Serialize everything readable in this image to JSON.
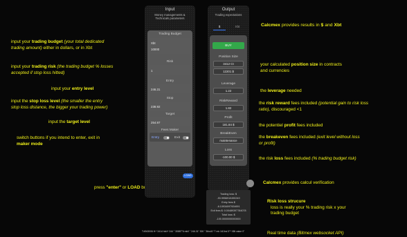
{
  "input_col": {
    "title": "Input",
    "subtitle": [
      "Money managements &",
      "Technicals parameters"
    ],
    "group_title": "Trading Budget",
    "budget_currency": "Xbt",
    "budget_value": "10000",
    "risk_label": "Risk",
    "risk_value": "1",
    "entry_label": "Entry",
    "entry_value": "246.31",
    "stop_label": "Stop",
    "stop_value": "238.92",
    "target_label": "Target",
    "target_value": "254.97",
    "feemaker_label": "Fees Maker",
    "feemaker_entry": "Entry",
    "feemaker_exit": "Exit",
    "load_label": "LOAD"
  },
  "output_col": {
    "title": "Output",
    "subtitle": "Trading expectations",
    "tab1": "$",
    "tab2": "Xbt",
    "buy_label": "BUY",
    "position_label": "Position Size",
    "position_contracts": "3412 Ct",
    "position_usd": "12201 $",
    "leverage_label": "Leverage",
    "leverage_value": "1.22",
    "rr_label": "RiskReward",
    "rr_value": "1.82",
    "profit_label": "Profit",
    "profit_value": "181.84 $",
    "breakeven_label": "BreakEven",
    "breakeven_value": "maintenance",
    "loss_label": "Loss",
    "loss_value": "-100.00 $"
  },
  "verification": {
    "lines": [
      "Trading loss: $",
      "-93.9956910490249",
      "Entry fees $",
      "-6.10934097924691",
      "Exit fees $: 0.00489397784078",
      "Total loss: $",
      "-100.0000000000000"
    ]
  },
  "ticker": "T:4943006 H:* 3414 hid:i* 244 \" 30887\"6 mk0 \" 246.31\" 300 \" 3ths40 \"7 mk 1t13nd 3\"* XBt value 0\"",
  "left_annotations": {
    "budget": {
      "a": "input your ",
      "b": "trading budget",
      "c": " (your total  dedicated",
      "d": "trading amount)",
      "e": "  either in dollars, or in Xbt"
    },
    "risk": {
      "a": "input your ",
      "b": "trading risk",
      "c": " (the trading budget % losses",
      "d": "accepted if stop loss hitted)"
    },
    "entry": {
      "a": "input your ",
      "b": "entry level"
    },
    "stop": {
      "a": "input the ",
      "b": "stop loss level",
      "c": " (the smaller the entry",
      "d": "stop loss distance, the bigger your trading power)"
    },
    "target": {
      "a": "input the ",
      "b": "target level"
    },
    "switch": {
      "a": "switch buttons if you intend to enter, exit in",
      "b": "maker mode"
    },
    "press": {
      "a": "press ",
      "b": "\"enter\"",
      "c": " or ",
      "d": "LOAD",
      "e": " button"
    }
  },
  "right_annotations": {
    "calcmex": {
      "a": "Calcmex",
      "b": " provides results in ",
      "c": "$",
      "d": " and ",
      "e": "Xbt"
    },
    "position": {
      "a": "your calculated ",
      "b": "position size",
      "c": " in contracts",
      "d": "and currencies"
    },
    "leverage": {
      "a": "the ",
      "b": "leverage",
      "c": " needed"
    },
    "rr": {
      "a": "the ",
      "b": "risk reward",
      "c": " fees included ",
      "d": "(potential gain to risk loss",
      "e": "ratio),",
      "f": "  discouraged <1"
    },
    "profit": {
      "a": "the potentiel ",
      "b": "profit",
      "c": " fees included"
    },
    "breakeven": {
      "a": "the ",
      "b": "breakeven",
      "c": " fees included ",
      "d": "(exit level without loss",
      "e": "or profit)"
    },
    "loss": {
      "a": "the risk ",
      "b": "loss",
      "c": " fees included ",
      "d": "(%  trading budget risk)"
    },
    "verif": {
      "a": "Calcmex",
      "b": " provides calcul verification"
    },
    "structure": {
      "a": "Risk loss strucure",
      "b": "loss is really your % trading risk x your",
      "c": "trading budget"
    },
    "realtime": {
      "a": "Real time data ",
      "b": "(Bitmex websocket API)"
    }
  },
  "colors": {
    "accent": "#f2f21a",
    "green": "#33a84a",
    "blue": "#2f6fdc"
  }
}
